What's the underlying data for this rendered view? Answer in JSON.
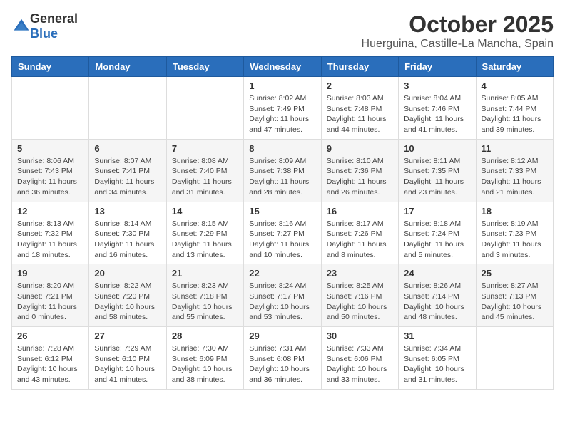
{
  "header": {
    "logo_general": "General",
    "logo_blue": "Blue",
    "month": "October 2025",
    "location": "Huerguina, Castille-La Mancha, Spain"
  },
  "weekdays": [
    "Sunday",
    "Monday",
    "Tuesday",
    "Wednesday",
    "Thursday",
    "Friday",
    "Saturday"
  ],
  "weeks": [
    [
      {
        "day": "",
        "info": ""
      },
      {
        "day": "",
        "info": ""
      },
      {
        "day": "",
        "info": ""
      },
      {
        "day": "1",
        "info": "Sunrise: 8:02 AM\nSunset: 7:49 PM\nDaylight: 11 hours\nand 47 minutes."
      },
      {
        "day": "2",
        "info": "Sunrise: 8:03 AM\nSunset: 7:48 PM\nDaylight: 11 hours\nand 44 minutes."
      },
      {
        "day": "3",
        "info": "Sunrise: 8:04 AM\nSunset: 7:46 PM\nDaylight: 11 hours\nand 41 minutes."
      },
      {
        "day": "4",
        "info": "Sunrise: 8:05 AM\nSunset: 7:44 PM\nDaylight: 11 hours\nand 39 minutes."
      }
    ],
    [
      {
        "day": "5",
        "info": "Sunrise: 8:06 AM\nSunset: 7:43 PM\nDaylight: 11 hours\nand 36 minutes."
      },
      {
        "day": "6",
        "info": "Sunrise: 8:07 AM\nSunset: 7:41 PM\nDaylight: 11 hours\nand 34 minutes."
      },
      {
        "day": "7",
        "info": "Sunrise: 8:08 AM\nSunset: 7:40 PM\nDaylight: 11 hours\nand 31 minutes."
      },
      {
        "day": "8",
        "info": "Sunrise: 8:09 AM\nSunset: 7:38 PM\nDaylight: 11 hours\nand 28 minutes."
      },
      {
        "day": "9",
        "info": "Sunrise: 8:10 AM\nSunset: 7:36 PM\nDaylight: 11 hours\nand 26 minutes."
      },
      {
        "day": "10",
        "info": "Sunrise: 8:11 AM\nSunset: 7:35 PM\nDaylight: 11 hours\nand 23 minutes."
      },
      {
        "day": "11",
        "info": "Sunrise: 8:12 AM\nSunset: 7:33 PM\nDaylight: 11 hours\nand 21 minutes."
      }
    ],
    [
      {
        "day": "12",
        "info": "Sunrise: 8:13 AM\nSunset: 7:32 PM\nDaylight: 11 hours\nand 18 minutes."
      },
      {
        "day": "13",
        "info": "Sunrise: 8:14 AM\nSunset: 7:30 PM\nDaylight: 11 hours\nand 16 minutes."
      },
      {
        "day": "14",
        "info": "Sunrise: 8:15 AM\nSunset: 7:29 PM\nDaylight: 11 hours\nand 13 minutes."
      },
      {
        "day": "15",
        "info": "Sunrise: 8:16 AM\nSunset: 7:27 PM\nDaylight: 11 hours\nand 10 minutes."
      },
      {
        "day": "16",
        "info": "Sunrise: 8:17 AM\nSunset: 7:26 PM\nDaylight: 11 hours\nand 8 minutes."
      },
      {
        "day": "17",
        "info": "Sunrise: 8:18 AM\nSunset: 7:24 PM\nDaylight: 11 hours\nand 5 minutes."
      },
      {
        "day": "18",
        "info": "Sunrise: 8:19 AM\nSunset: 7:23 PM\nDaylight: 11 hours\nand 3 minutes."
      }
    ],
    [
      {
        "day": "19",
        "info": "Sunrise: 8:20 AM\nSunset: 7:21 PM\nDaylight: 11 hours\nand 0 minutes."
      },
      {
        "day": "20",
        "info": "Sunrise: 8:22 AM\nSunset: 7:20 PM\nDaylight: 10 hours\nand 58 minutes."
      },
      {
        "day": "21",
        "info": "Sunrise: 8:23 AM\nSunset: 7:18 PM\nDaylight: 10 hours\nand 55 minutes."
      },
      {
        "day": "22",
        "info": "Sunrise: 8:24 AM\nSunset: 7:17 PM\nDaylight: 10 hours\nand 53 minutes."
      },
      {
        "day": "23",
        "info": "Sunrise: 8:25 AM\nSunset: 7:16 PM\nDaylight: 10 hours\nand 50 minutes."
      },
      {
        "day": "24",
        "info": "Sunrise: 8:26 AM\nSunset: 7:14 PM\nDaylight: 10 hours\nand 48 minutes."
      },
      {
        "day": "25",
        "info": "Sunrise: 8:27 AM\nSunset: 7:13 PM\nDaylight: 10 hours\nand 45 minutes."
      }
    ],
    [
      {
        "day": "26",
        "info": "Sunrise: 7:28 AM\nSunset: 6:12 PM\nDaylight: 10 hours\nand 43 minutes."
      },
      {
        "day": "27",
        "info": "Sunrise: 7:29 AM\nSunset: 6:10 PM\nDaylight: 10 hours\nand 41 minutes."
      },
      {
        "day": "28",
        "info": "Sunrise: 7:30 AM\nSunset: 6:09 PM\nDaylight: 10 hours\nand 38 minutes."
      },
      {
        "day": "29",
        "info": "Sunrise: 7:31 AM\nSunset: 6:08 PM\nDaylight: 10 hours\nand 36 minutes."
      },
      {
        "day": "30",
        "info": "Sunrise: 7:33 AM\nSunset: 6:06 PM\nDaylight: 10 hours\nand 33 minutes."
      },
      {
        "day": "31",
        "info": "Sunrise: 7:34 AM\nSunset: 6:05 PM\nDaylight: 10 hours\nand 31 minutes."
      },
      {
        "day": "",
        "info": ""
      }
    ]
  ]
}
